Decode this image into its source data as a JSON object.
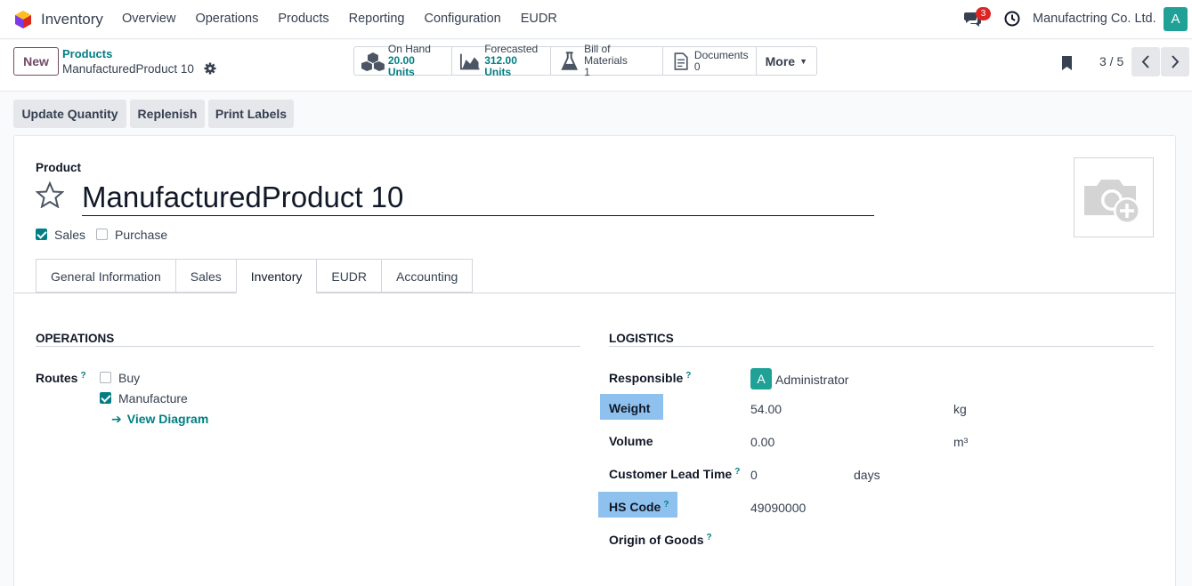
{
  "navbar": {
    "app_name": "Inventory",
    "menu": [
      "Overview",
      "Operations",
      "Products",
      "Reporting",
      "Configuration",
      "EUDR"
    ],
    "chat_count": "3",
    "company": "Manufactring Co. Ltd.",
    "user_initial": "A"
  },
  "control": {
    "new_label": "New",
    "breadcrumb_parent": "Products",
    "breadcrumb_current": "ManufacturedProduct 10",
    "smart_buttons": [
      {
        "label": "On Hand",
        "value": "20.00 Units",
        "icon": "cubes-icon"
      },
      {
        "label": "Forecasted",
        "value": "312.00 Units",
        "icon": "area-chart-icon"
      },
      {
        "label": "Bill of Materials",
        "value": "1",
        "icon": "flask-icon"
      },
      {
        "label": "Documents",
        "value": "0",
        "icon": "document-icon"
      }
    ],
    "more_label": "More",
    "pager": "3 / 5"
  },
  "actions": [
    "Update Quantity",
    "Replenish",
    "Print Labels"
  ],
  "form": {
    "product_label": "Product",
    "product_name": "ManufacturedProduct 10",
    "sales_label": "Sales",
    "sales_checked": true,
    "purchase_label": "Purchase",
    "purchase_checked": false,
    "tabs": [
      "General Information",
      "Sales",
      "Inventory",
      "EUDR",
      "Accounting"
    ],
    "active_tab": "Inventory"
  },
  "operations": {
    "title": "OPERATIONS",
    "routes_label": "Routes",
    "routes": [
      {
        "label": "Buy",
        "checked": false
      },
      {
        "label": "Manufacture",
        "checked": true
      }
    ],
    "view_diagram": "View Diagram"
  },
  "logistics": {
    "title": "LOGISTICS",
    "responsible_label": "Responsible",
    "responsible_initial": "A",
    "responsible_value": "Administrator",
    "weight_label": "Weight",
    "weight_value": "54.00",
    "weight_unit": "kg",
    "volume_label": "Volume",
    "volume_value": "0.00",
    "volume_unit": "m³",
    "lead_time_label": "Customer Lead Time",
    "lead_time_value": "0",
    "lead_time_unit": "days",
    "hs_code_label": "HS Code",
    "hs_code_value": "49090000",
    "origin_label": "Origin of Goods",
    "help_mark": "?"
  },
  "colors": {
    "accent": "#017e84",
    "brand": "#714b67",
    "highlight": "#8ec1ee"
  }
}
